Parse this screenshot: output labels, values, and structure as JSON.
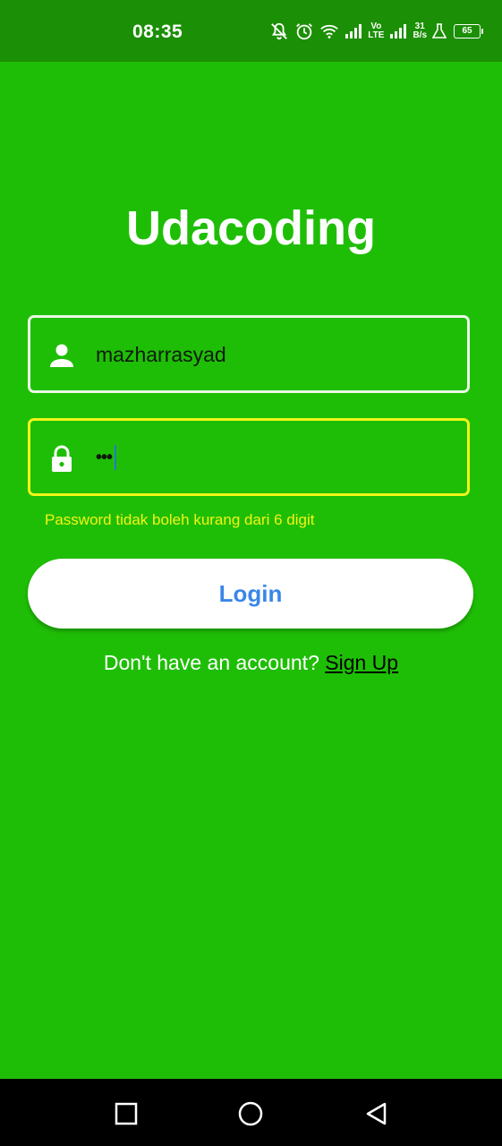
{
  "status_bar": {
    "time": "08:35",
    "network_lte_top": "Vo",
    "network_lte_bottom": "LTE",
    "speed_value": "31",
    "speed_unit": "B/s",
    "battery_level": "65",
    "icons": [
      "mute-bell-icon",
      "alarm-icon",
      "wifi-icon",
      "signal-icon",
      "signal-icon-2",
      "flask-icon",
      "battery-icon"
    ]
  },
  "app": {
    "title": "Udacoding"
  },
  "form": {
    "username_value": "mazharrasyad",
    "password_mask": "•••",
    "password_error": "Password tidak boleh kurang dari 6 digit",
    "login_label": "Login",
    "signup_prompt": "Don't have an account? ",
    "signup_link": "Sign Up"
  },
  "colors": {
    "background": "#1fbe06",
    "status_bar": "#1b8f05",
    "error_accent": "#f1f518",
    "button_text": "#3a86e8"
  },
  "nav_bar": {
    "icons": [
      "recent-apps-icon",
      "home-icon",
      "back-icon"
    ]
  }
}
